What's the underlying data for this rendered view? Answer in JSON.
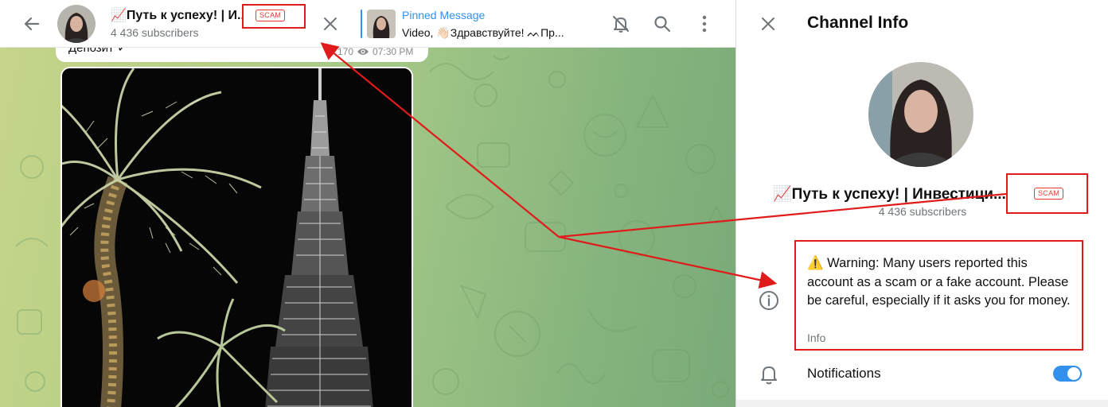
{
  "chat": {
    "header": {
      "title": "📈Путь к успеху! | И..",
      "subscribers": "4 436 subscribers",
      "badge": "SCAM"
    },
    "pinned": {
      "label": "Pinned Message",
      "text": "Video, 👋🏻Здравствуйте! ᨓПр..."
    },
    "message": {
      "text": "Депозит ✓",
      "views": "170",
      "time": "07:30 PM"
    },
    "icons": [
      "arrow-left-icon",
      "close-icon",
      "bell-off-icon",
      "search-icon",
      "more-vertical-icon",
      "eye-icon"
    ]
  },
  "panel": {
    "title": "Channel Info",
    "name": "📈Путь к успеху! | Инвестици...",
    "badge": "SCAM",
    "subscribers": "4 436 subscribers",
    "warning": "⚠️ Warning: Many users reported this account as a scam or a fake account. Please be careful, especially if it asks you for money.",
    "warning_label": "Info",
    "notifications_label": "Notifications",
    "notifications_on": true,
    "icons": [
      "close-icon",
      "info-icon",
      "bell-icon"
    ]
  },
  "colors": {
    "accent": "#3390ec",
    "scam": "#e53935",
    "annotation": "#e01b1b"
  }
}
